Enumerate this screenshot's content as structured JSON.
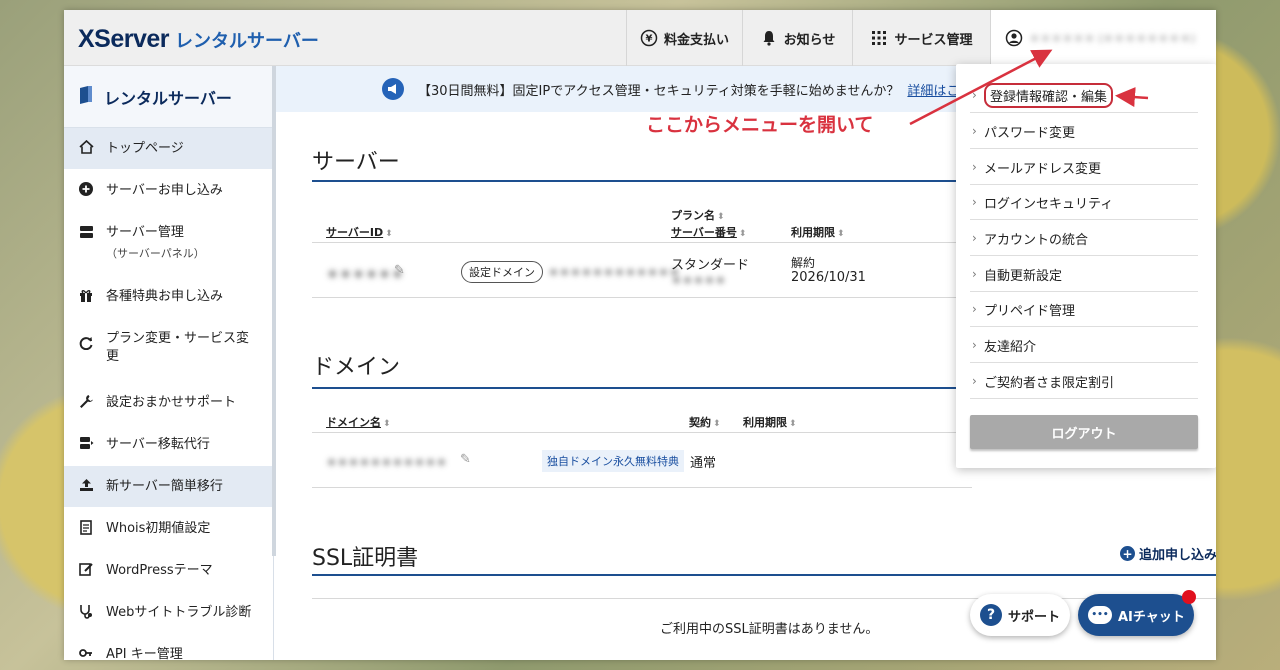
{
  "header": {
    "logo_main": "XServer",
    "logo_sub": "レンタルサーバー",
    "buttons": [
      {
        "label": "料金支払い",
        "icon": "yen-icon"
      },
      {
        "label": "お知らせ",
        "icon": "bell-icon"
      },
      {
        "label": "サービス管理",
        "icon": "grid-icon"
      }
    ],
    "user_label": "＊＊＊＊＊＊ (＊＊＊＊＊＊＊＊)"
  },
  "sidebar": {
    "title": "レンタルサーバー",
    "items": [
      {
        "label": "トップページ",
        "icon": "home-icon",
        "active": true
      },
      {
        "label": "サーバーお申し込み",
        "icon": "plus-circle-icon"
      },
      {
        "label": "サーバー管理",
        "sub": "（サーバーパネル）",
        "icon": "server-icon"
      },
      {
        "label": "各種特典お申し込み",
        "icon": "gift-icon"
      },
      {
        "label": "プラン変更・サービス変更",
        "icon": "refresh-icon"
      },
      {
        "label": "設定おまかせサポート",
        "icon": "wrench-icon"
      },
      {
        "label": "サーバー移転代行",
        "icon": "server-move-icon"
      },
      {
        "label": "新サーバー簡単移行",
        "icon": "upload-icon",
        "active": true
      },
      {
        "label": "Whois初期値設定",
        "icon": "document-icon"
      },
      {
        "label": "WordPressテーマ",
        "icon": "edit-icon"
      },
      {
        "label": "Webサイトトラブル診断",
        "icon": "stethoscope-icon"
      },
      {
        "label": "API キー管理",
        "icon": "key-icon"
      }
    ]
  },
  "banner": {
    "text": "【30日間無料】固定IPでアクセス管理・セキュリティ対策を手軽に始めませんか？",
    "link": "詳細はこ"
  },
  "server": {
    "title": "サーバー",
    "columns": [
      "サーバーID",
      "プラン名",
      "サーバー番号",
      "利用期限"
    ],
    "row": {
      "id": "＊＊＊＊＊＊",
      "tag": "設定ドメイン",
      "domain": "＊＊＊＊＊＊＊＊＊＊＊＊",
      "plan": "スタンダード",
      "number": "＊＊＊＊＊",
      "status": "解約",
      "expiry": "2026/10/31"
    }
  },
  "domain": {
    "title": "ドメイン",
    "columns": [
      "ドメイン名",
      "契約",
      "利用期限"
    ],
    "row": {
      "name": "＊＊＊＊＊＊＊＊＊＊＊",
      "tag": "独自ドメイン永久無料特典",
      "contract": "通常"
    }
  },
  "ssl": {
    "title": "SSL証明書",
    "add": "追加申し込み",
    "empty": "ご利用中のSSL証明書はありません。"
  },
  "dropdown": {
    "items": [
      "登録情報確認・編集",
      "パスワード変更",
      "メールアドレス変更",
      "ログインセキュリティ",
      "アカウントの統合",
      "自動更新設定",
      "プリペイド管理",
      "友達紹介",
      "ご契約者さま限定割引"
    ],
    "logout": "ログアウト"
  },
  "annotation": "ここからメニューを開いて",
  "fab": {
    "help": "サポート",
    "ai": "AIチャット"
  },
  "colors": {
    "brand": "#0b2a5c",
    "accent": "#1d4f8f",
    "annotation": "#d9323f"
  }
}
